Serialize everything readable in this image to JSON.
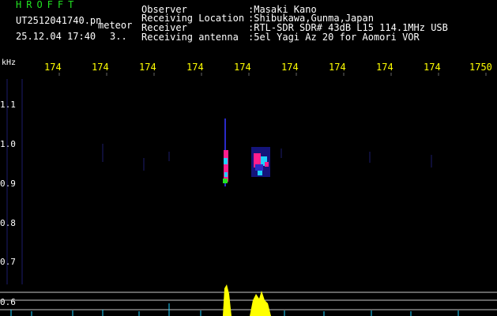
{
  "header": {
    "brand": "HROFFT",
    "filename": "UT2512041740.pn",
    "program": "meteor",
    "datetime": "25.12.04 17:40",
    "counter": "3.."
  },
  "info": {
    "observer_label": "Observer",
    "observer_value": ":Masaki Kano",
    "location_label": "Receiving Location",
    "location_value": ":Shibukawa,Gunma,Japan",
    "receiver_label": "Receiver",
    "receiver_value": ":RTL-SDR SDR# 43dB L15 114.1MHz USB",
    "antenna_label": "Receiving antenna",
    "antenna_value": ":5el Yagi Az 20 for Aomori VOR"
  },
  "axis": {
    "unit": "kHz",
    "freq_ticks": [
      "174",
      "174",
      "174",
      "174",
      "174",
      "174",
      "174",
      "174",
      "174",
      "1750"
    ],
    "y_ticks": [
      "1.1",
      "1.0",
      "0.9",
      "0.8",
      "0.7",
      "0.6"
    ]
  },
  "colors": {
    "background": "#000000",
    "text_green": "#22e222",
    "text_white": "#ffffff",
    "freq_tick": "#ffff00",
    "echo_hot": "#ff1e8c",
    "echo_mid": "#1ed2ff",
    "echo_low": "#2828c8",
    "spectrum_fill": "#ffff00",
    "baseline": "#c8c8c8"
  }
}
